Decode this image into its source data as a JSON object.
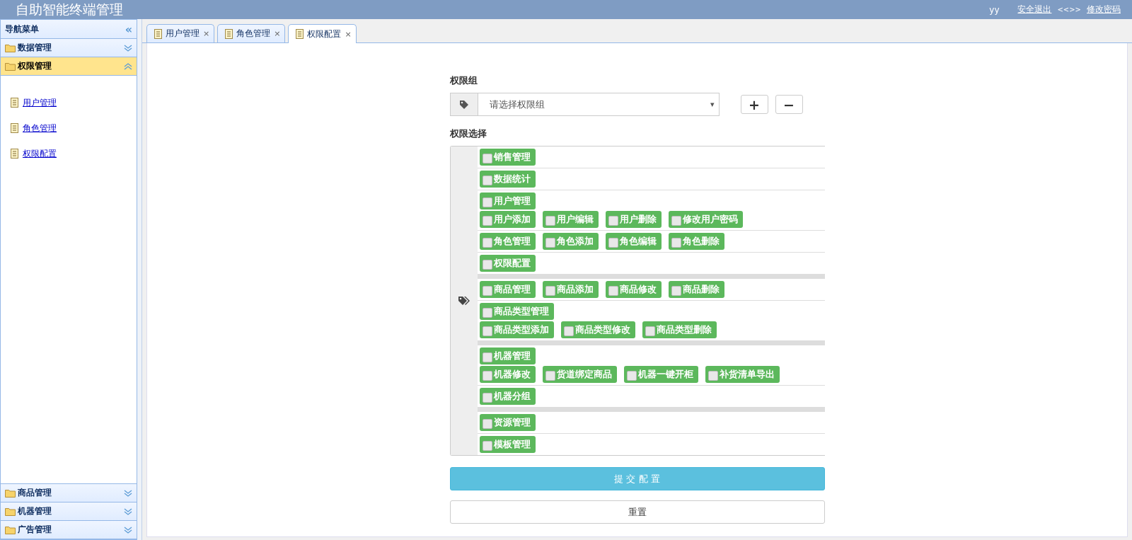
{
  "header": {
    "title": "自助智能终端管理",
    "user": "yy",
    "logout_link": "安全退出",
    "separator": "<<>>",
    "password_link": "修改密码"
  },
  "sidebar": {
    "title": "导航菜单",
    "collapse_icon": "«",
    "sections": [
      {
        "label": "数据管理",
        "expanded": false
      },
      {
        "label": "权限管理",
        "expanded": true,
        "children": [
          {
            "label": "用户管理"
          },
          {
            "label": "角色管理"
          },
          {
            "label": "权限配置"
          }
        ]
      },
      {
        "label": "商品管理",
        "expanded": false
      },
      {
        "label": "机器管理",
        "expanded": false
      },
      {
        "label": "广告管理",
        "expanded": false
      }
    ]
  },
  "tabs": [
    {
      "label": "用户管理",
      "selected": false,
      "close": "×"
    },
    {
      "label": "角色管理",
      "selected": false,
      "close": "×"
    },
    {
      "label": "权限配置",
      "selected": true,
      "close": "×"
    }
  ],
  "form": {
    "group_label": "权限组",
    "group_select": {
      "placeholder": "请选择权限组",
      "arrow": "▾"
    },
    "add_button": "+",
    "remove_button": "−",
    "permission_label": "权限选择",
    "permission_groups": [
      {
        "blocks": [
          [
            [
              {
                "label": "销售管理",
                "checked": false
              }
            ]
          ],
          [
            [
              {
                "label": "数据统计",
                "checked": false
              }
            ]
          ],
          [
            [
              {
                "label": "用户管理",
                "checked": false
              }
            ],
            [
              {
                "label": "用户添加",
                "checked": false
              },
              {
                "label": "用户编辑",
                "checked": false
              },
              {
                "label": "用户删除",
                "checked": false
              },
              {
                "label": "修改用户密码",
                "checked": false
              }
            ]
          ],
          [
            [
              {
                "label": "角色管理",
                "checked": false
              },
              {
                "label": "角色添加",
                "checked": false
              },
              {
                "label": "角色编辑",
                "checked": false
              },
              {
                "label": "角色删除",
                "checked": false
              }
            ]
          ],
          [
            [
              {
                "label": "权限配置",
                "checked": false
              }
            ]
          ]
        ]
      },
      {
        "blocks": [
          [
            [
              {
                "label": "商品管理",
                "checked": false
              },
              {
                "label": "商品添加",
                "checked": false
              },
              {
                "label": "商品修改",
                "checked": false
              },
              {
                "label": "商品删除",
                "checked": false
              }
            ]
          ],
          [
            [
              {
                "label": "商品类型管理",
                "checked": false
              }
            ],
            [
              {
                "label": "商品类型添加",
                "checked": false
              },
              {
                "label": "商品类型修改",
                "checked": false
              },
              {
                "label": "商品类型删除",
                "checked": false
              }
            ]
          ]
        ]
      },
      {
        "blocks": [
          [
            [
              {
                "label": "机器管理",
                "checked": false
              }
            ],
            [
              {
                "label": "机器修改",
                "checked": false
              },
              {
                "label": "货道绑定商品",
                "checked": false
              },
              {
                "label": "机器一键开柜",
                "checked": false
              },
              {
                "label": "补货清单导出",
                "checked": false
              }
            ]
          ],
          [
            [
              {
                "label": "机器分组",
                "checked": false
              }
            ]
          ]
        ]
      },
      {
        "blocks": [
          [
            [
              {
                "label": "资源管理",
                "checked": false
              }
            ]
          ],
          [
            [
              {
                "label": "模板管理",
                "checked": false
              }
            ]
          ]
        ]
      }
    ],
    "submit_button": "提 交 配 置",
    "reset_button": "重置"
  }
}
